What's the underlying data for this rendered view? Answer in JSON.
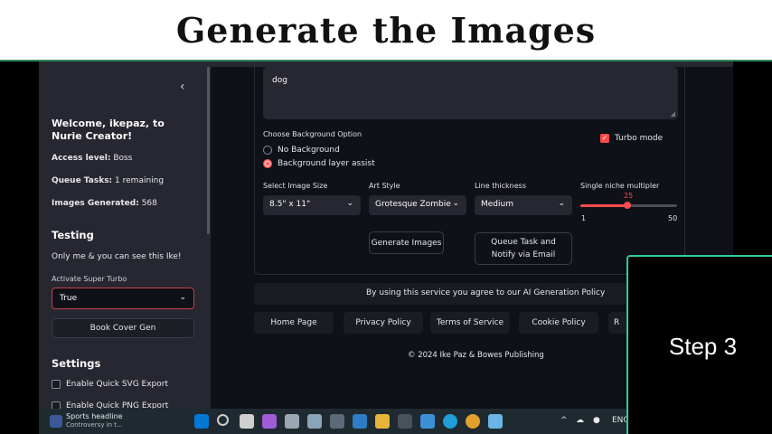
{
  "banner": {
    "title": "Generate the Images"
  },
  "sidebar": {
    "welcome": "Welcome, ikepaz, to Nurie Creator!",
    "access_level_label": "Access level:",
    "access_level_value": "Boss",
    "queue_label": "Queue Tasks:",
    "queue_value": "1 remaining",
    "images_label": "Images Generated:",
    "images_value": "568",
    "testing_heading": "Testing",
    "testing_note": "Only me & you can see this Ike!",
    "super_turbo_label": "Activate Super Turbo",
    "super_turbo_value": "True",
    "book_cover_button": "Book Cover Gen",
    "settings_heading": "Settings",
    "svg_export_label": "Enable Quick SVG Export",
    "png_export_label": "Enable Quick PNG Export"
  },
  "main": {
    "prompt_value": "dog",
    "bg_option_label": "Choose Background Option",
    "bg_options": [
      "No Background",
      "Background layer assist"
    ],
    "bg_selected": "Background layer assist",
    "turbo_label": "Turbo mode",
    "turbo_checked": true,
    "image_size_label": "Select Image Size",
    "image_size_value": "8.5\" x 11\"",
    "art_style_label": "Art Style",
    "art_style_value": "Grotesque Zombie",
    "line_thickness_label": "Line thickness",
    "line_thickness_value": "Medium",
    "niche_label": "Single niche multipler",
    "niche_value": 25,
    "niche_min": 1,
    "niche_max": 50,
    "niche_value_text": "25",
    "niche_min_text": "1",
    "niche_max_text": "50",
    "generate_button": "Generate Images",
    "queue_button": "Queue Task and Notify via Email"
  },
  "footer": {
    "policy_notice": "By using this service you agree to our AI Generation Policy",
    "nav": [
      "Home Page",
      "Privacy Policy",
      "Terms of Service",
      "Cookie Policy",
      "R"
    ],
    "copyright": "© 2024 Ike Paz & Bowes Publishing"
  },
  "overlay": {
    "step_label": "Step 3"
  },
  "taskbar": {
    "news_title": "Sports headline",
    "news_sub": "Controversy in t...",
    "language": "ENG"
  },
  "colors": {
    "accent": "#ff4b4b",
    "sidebar_bg": "#262730",
    "app_bg": "#0e1117",
    "overlay_border": "#2ecc9a"
  }
}
